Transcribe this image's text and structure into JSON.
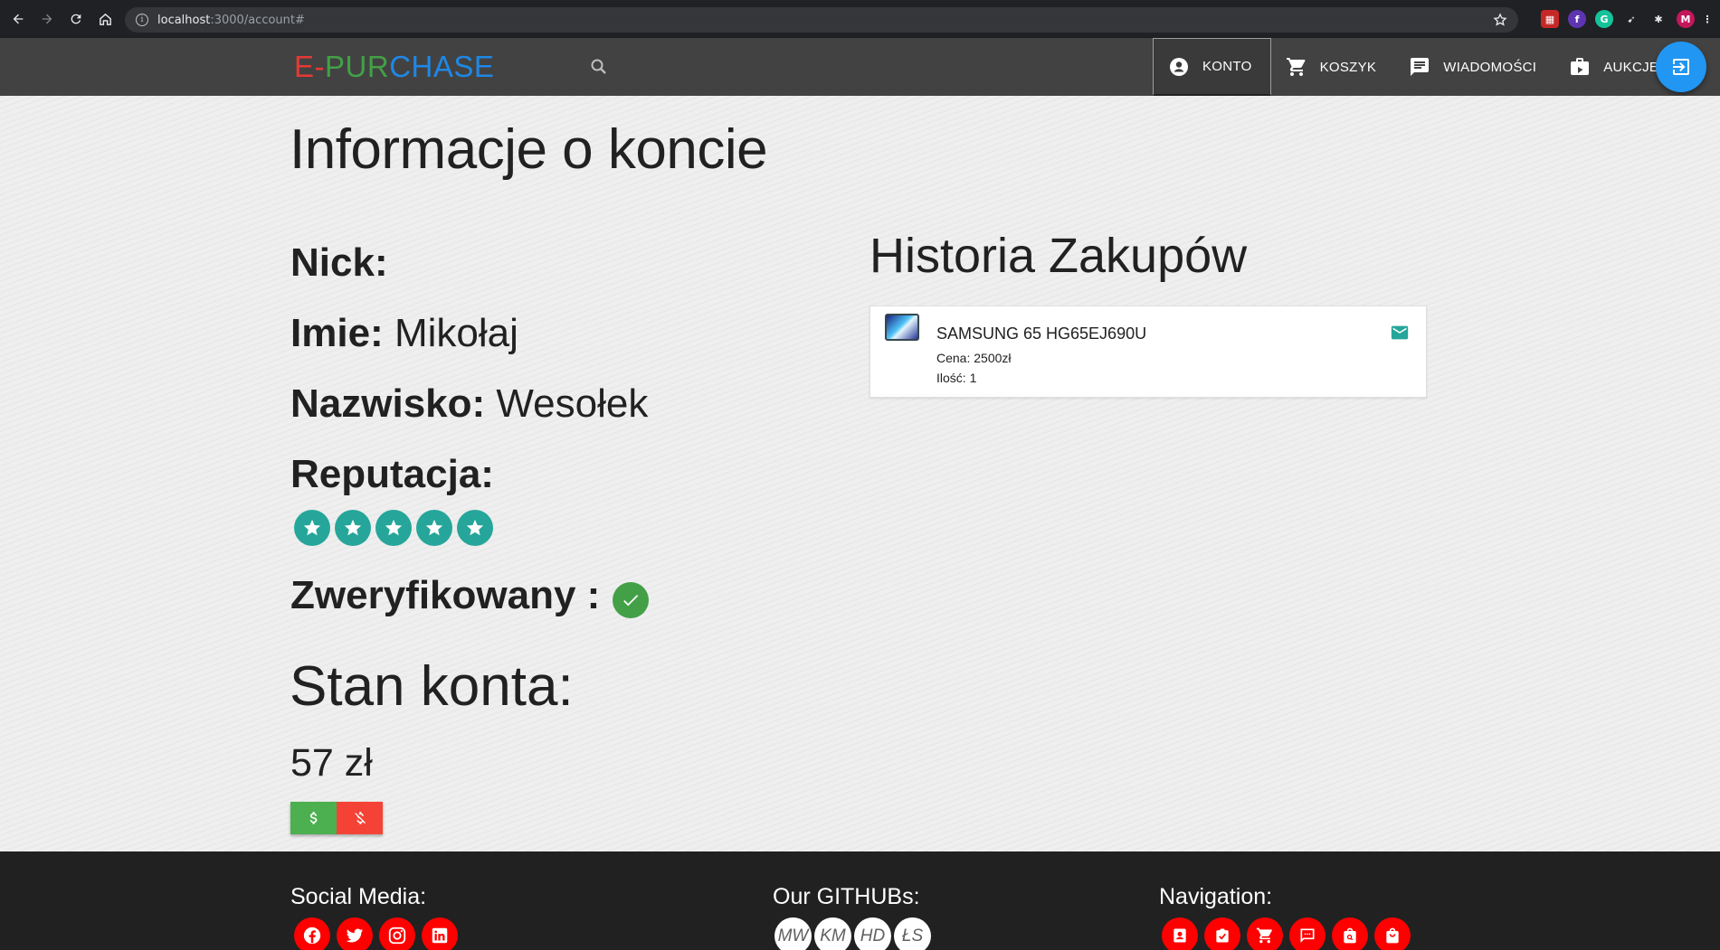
{
  "browser": {
    "url_host": "localhost",
    "url_path": ":3000/account#"
  },
  "header": {
    "logo": {
      "e": "E-",
      "p1": "PUR",
      "p2": "CHASE"
    },
    "menu": [
      {
        "label": "KONTO",
        "icon": "account-circle-icon"
      },
      {
        "label": "KOSZYK",
        "icon": "cart-icon"
      },
      {
        "label": "WIADOMOŚCI",
        "icon": "message-icon"
      },
      {
        "label": "AUKCJE",
        "icon": "auction-icon"
      }
    ]
  },
  "account": {
    "title": "Informacje o koncie",
    "nick_label": "Nick:",
    "nick_value": "",
    "imie_label": "Imie:",
    "imie_value": "Mikołaj",
    "nazwisko_label": "Nazwisko:",
    "nazwisko_value": "Wesołek",
    "reputacja_label": "Reputacja:",
    "reputation_stars": 5,
    "verified_label": "Zweryfikowany :",
    "verified": true,
    "balance_title": "Stan konta:",
    "balance_value": "57 zł"
  },
  "history": {
    "title": "Historia Zakupów",
    "items": [
      {
        "name": "SAMSUNG 65 HG65EJ690U",
        "price": "Cena: 2500zł",
        "qty": "Ilość: 1"
      }
    ]
  },
  "footer": {
    "social_heading": "Social Media:",
    "github_heading": "Our GITHUBs:",
    "github_initials": [
      "MW",
      "KM",
      "HD",
      "ŁS"
    ],
    "nav_heading": "Navigation:"
  },
  "colors": {
    "header_bg": "#424242",
    "accent_teal": "#26a69a",
    "fab_blue": "#2196f3",
    "footer_bg": "#212121",
    "footer_icon_red": "#ff0000"
  }
}
